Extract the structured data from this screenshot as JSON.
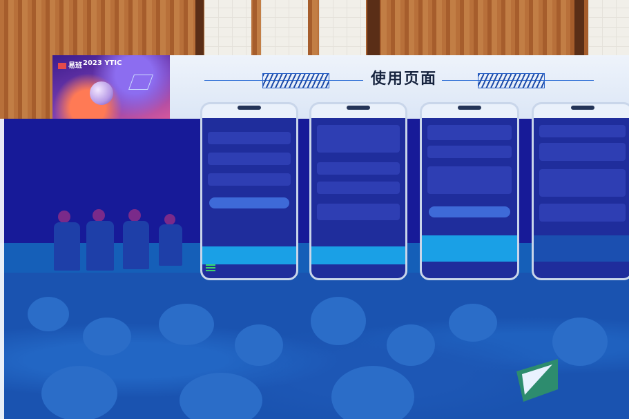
{
  "banner": {
    "brand": "易班",
    "event": "2023 YTIC"
  },
  "screen": {
    "title": "使用页面"
  }
}
